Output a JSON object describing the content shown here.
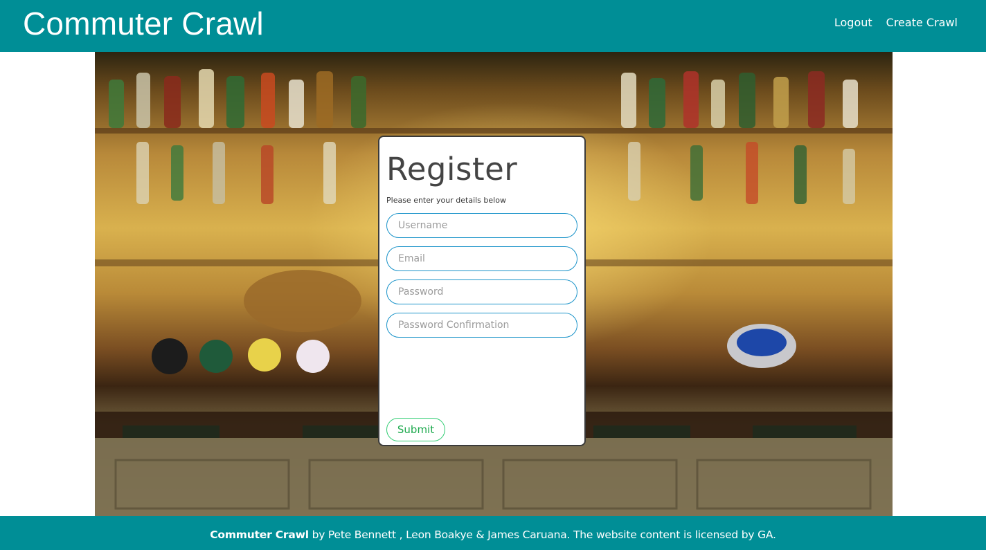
{
  "header": {
    "brand": "Commuter Crawl",
    "nav": [
      {
        "label": "Logout"
      },
      {
        "label": "Create Crawl"
      }
    ]
  },
  "register": {
    "title": "Register",
    "subtitle": "Please enter your details below",
    "fields": {
      "username": {
        "placeholder": "Username",
        "value": ""
      },
      "email": {
        "placeholder": "Email",
        "value": ""
      },
      "password": {
        "placeholder": "Password",
        "value": ""
      },
      "password_confirmation": {
        "placeholder": "Password Confirmation",
        "value": ""
      }
    },
    "submit_label": "Submit"
  },
  "footer": {
    "brand": "Commuter Crawl",
    "credits": " by Pete Bennett , Leon Boakye & James Caruana. The website content is licensed by GA."
  },
  "colors": {
    "navbar": "#008e96",
    "input_border": "#1a93c9",
    "submit_border": "#2ecc71"
  },
  "icons": {
    "hero": "pub-bar-photo"
  }
}
